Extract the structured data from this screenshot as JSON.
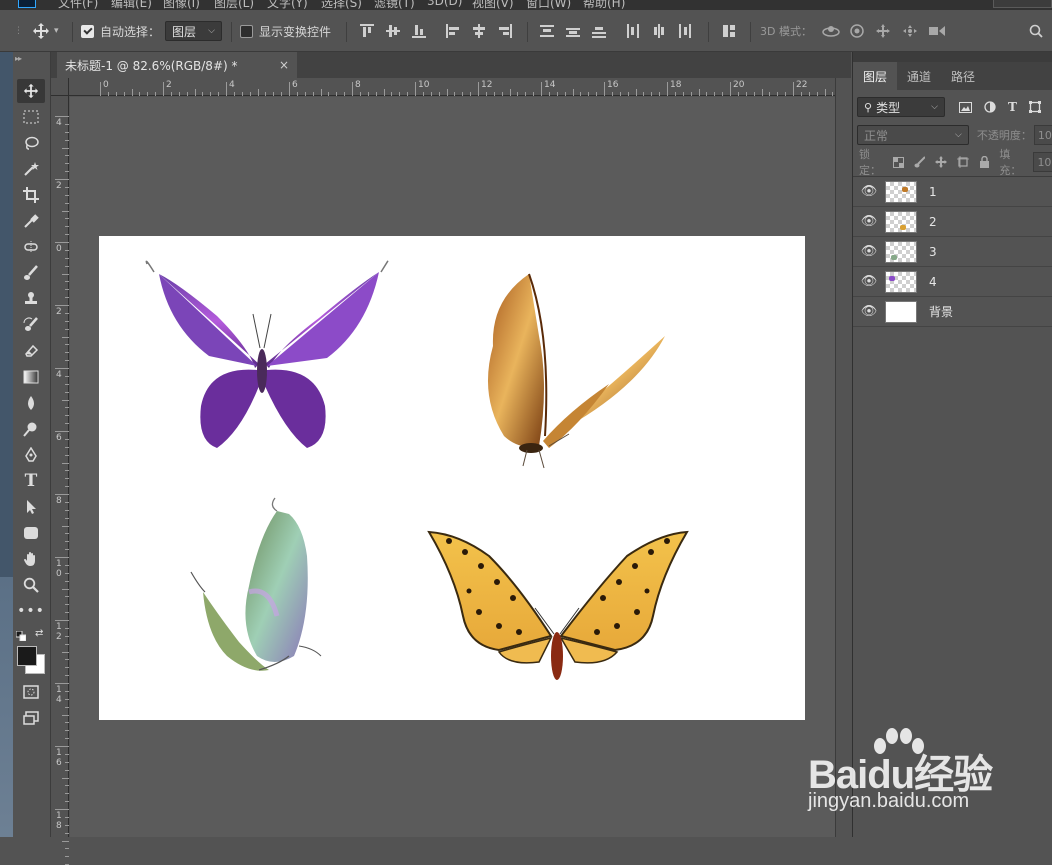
{
  "menu": {
    "items": [
      "文件(F)",
      "编辑(E)",
      "图像(I)",
      "图层(L)",
      "文字(Y)",
      "选择(S)",
      "滤镜(T)",
      "3D(D)",
      "视图(V)",
      "窗口(W)",
      "帮助(H)"
    ]
  },
  "options": {
    "move_icon": "move-arrows-icon",
    "auto_select_label": "自动选择：",
    "auto_select_checked": true,
    "auto_select_target": "图层",
    "show_transform_label": "显示变换控件",
    "show_transform_checked": false,
    "mode_3d_label": "3D 模式："
  },
  "document": {
    "tab_title": "未标题-1 @ 82.6%(RGB/8#) *",
    "close_glyph": "×",
    "canvas_background": "#ffffff"
  },
  "rulers": {
    "top": [
      "0",
      "2",
      "4",
      "6",
      "8",
      "10",
      "12",
      "14",
      "16",
      "18",
      "20",
      "22"
    ],
    "left": [
      {
        "chars": [
          "4"
        ]
      },
      {
        "chars": [
          "2"
        ]
      },
      {
        "chars": [
          "0"
        ]
      },
      {
        "chars": [
          "2"
        ]
      },
      {
        "chars": [
          "4"
        ]
      },
      {
        "chars": [
          "6"
        ]
      },
      {
        "chars": [
          "8"
        ]
      },
      {
        "chars": [
          "1",
          "0"
        ]
      },
      {
        "chars": [
          "1",
          "2"
        ]
      },
      {
        "chars": [
          "1",
          "4"
        ]
      },
      {
        "chars": [
          "1",
          "6"
        ]
      },
      {
        "chars": [
          "1",
          "8"
        ]
      }
    ]
  },
  "tools": [
    "move-tool-icon",
    "marquee-tool-icon",
    "lasso-tool-icon",
    "magic-wand-icon",
    "crop-tool-icon",
    "eyedropper-icon",
    "healing-brush-icon",
    "brush-tool-icon",
    "clone-stamp-icon",
    "history-brush-icon",
    "eraser-icon",
    "gradient-tool-icon",
    "blur-tool-icon",
    "dodge-tool-icon",
    "pen-tool-icon",
    "type-tool-icon",
    "path-selection-icon",
    "rectangle-shape-icon",
    "hand-tool-icon",
    "zoom-tool-icon",
    "more-tools-icon"
  ],
  "colors": {
    "foreground": "#1a1a1a",
    "background": "#ffffff",
    "accent": "#31a8ff"
  },
  "panel": {
    "tabs": [
      "图层",
      "通道",
      "路径"
    ],
    "active_tab": "图层",
    "filter_label": "类型",
    "blend_mode": "正常",
    "opacity_label": "不透明度：",
    "opacity_value": "10",
    "lock_label": "锁定：",
    "fill_label": "填充：",
    "fill_value": "10",
    "layers": [
      {
        "name": "1",
        "visible": true,
        "thumb": "butterfly-orange"
      },
      {
        "name": "2",
        "visible": true,
        "thumb": "butterfly-yellow"
      },
      {
        "name": "3",
        "visible": true,
        "thumb": "butterfly-green"
      },
      {
        "name": "4",
        "visible": true,
        "thumb": "butterfly-purple"
      },
      {
        "name": "背景",
        "visible": true,
        "thumb": "white"
      }
    ]
  },
  "watermark": {
    "logo": "Baidu经验",
    "url": "jingyan.baidu.com"
  }
}
